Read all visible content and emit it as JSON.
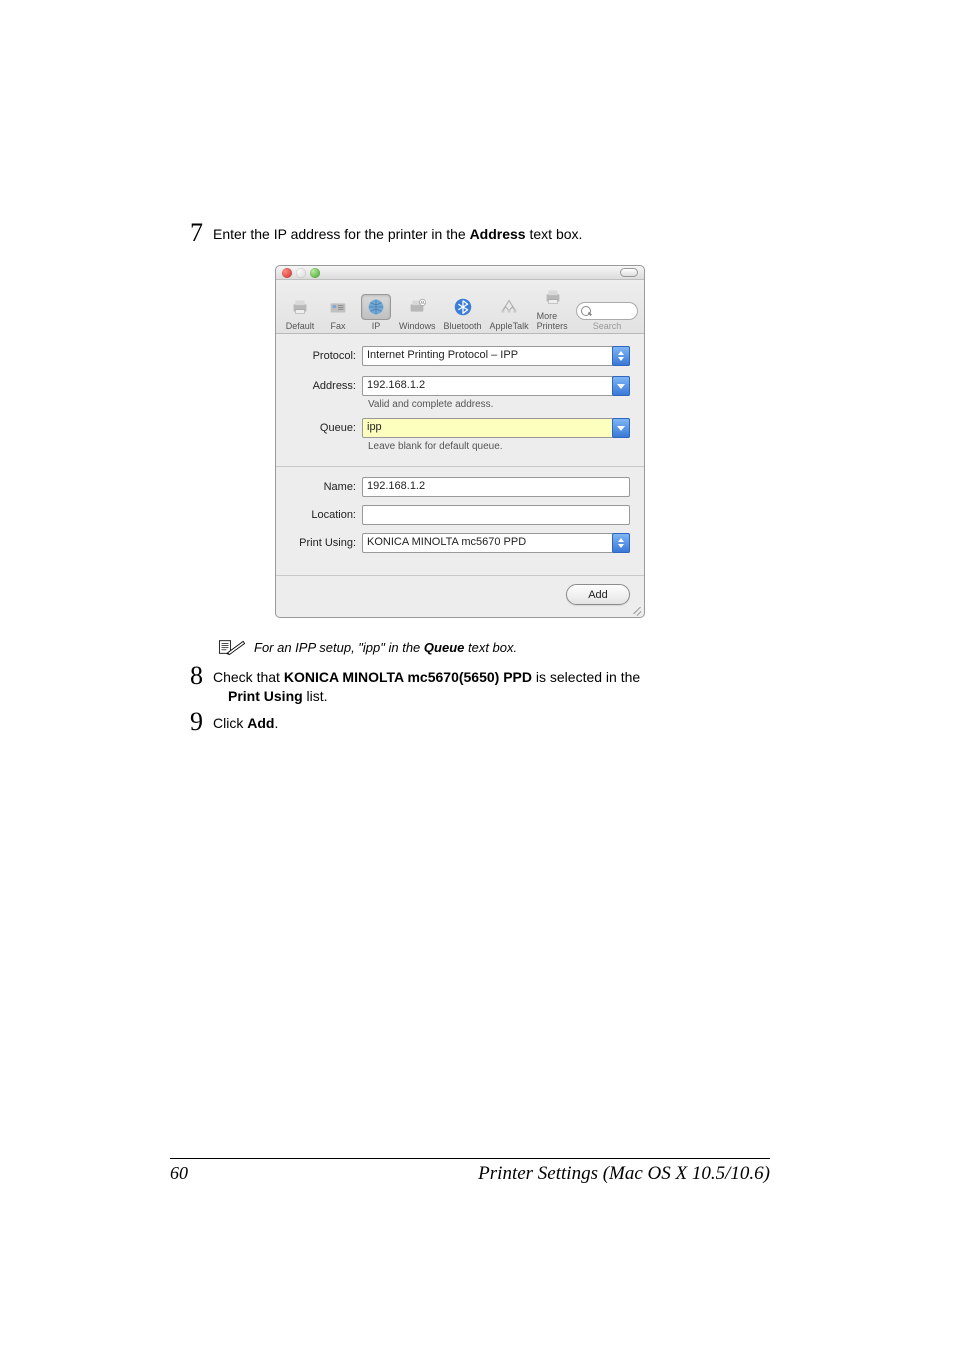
{
  "step7": {
    "num": "7",
    "text_before": "Enter the IP address for the printer in the ",
    "bold": "Address",
    "text_after": " text box."
  },
  "window": {
    "toolbar": {
      "items": [
        "Default",
        "Fax",
        "IP",
        "Windows",
        "Bluetooth",
        "AppleTalk",
        "More Printers"
      ],
      "selected_index": 2,
      "search_label": "Search"
    },
    "form": {
      "protocol": {
        "label": "Protocol:",
        "value": "Internet Printing Protocol – IPP"
      },
      "address": {
        "label": "Address:",
        "value": "192.168.1.2",
        "hint": "Valid and complete address."
      },
      "queue": {
        "label": "Queue:",
        "value": "ipp",
        "hint": "Leave blank for default queue."
      },
      "name": {
        "label": "Name:",
        "value": "192.168.1.2"
      },
      "location": {
        "label": "Location:",
        "value": ""
      },
      "print_using": {
        "label": "Print Using:",
        "value": "KONICA MINOLTA mc5670 PPD"
      }
    },
    "add_button": "Add"
  },
  "note": {
    "text_before": "For an IPP setup, \"ipp\" in the ",
    "bold": "Queue",
    "text_after": " text box."
  },
  "step8": {
    "num": "8",
    "text_before": "Check that ",
    "bold1": "KONICA MINOLTA mc5670(5650) PPD",
    "text_mid": " is selected in the ",
    "bold2": "Print Using",
    "text_after": " list."
  },
  "step9": {
    "num": "9",
    "text_before": "Click ",
    "bold": "Add",
    "text_after": "."
  },
  "footer": {
    "page": "60",
    "title": "Printer Settings (Mac OS X 10.5/10.6)"
  }
}
